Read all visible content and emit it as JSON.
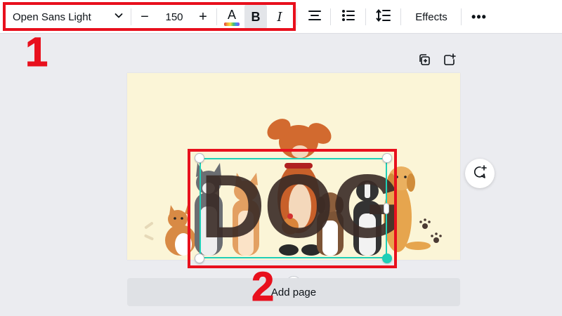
{
  "toolbar": {
    "font_family": "Open Sans Light",
    "font_size": "150",
    "minus_label": "−",
    "plus_label": "+",
    "text_color_label": "A",
    "bold_label": "B",
    "italic_label": "I",
    "effects_label": "Effects",
    "more_label": "•••"
  },
  "annotations": {
    "marker_1": "1",
    "marker_2": "2",
    "color": "#e8101d"
  },
  "canvas": {
    "text": "DOG",
    "text_color": "#3a2b26",
    "background_color": "#fbf5d7",
    "selection_color": "#1fcfb7"
  },
  "add_page_label": "Add page",
  "icons": {
    "font_dropdown": "chevron-down-icon",
    "align": "align-center-icon",
    "list": "bulleted-list-icon",
    "spacing": "line-spacing-icon",
    "duplicate_page": "duplicate-page-icon",
    "add_page_top": "add-page-icon",
    "comment": "add-comment-icon",
    "rotate": "rotate-icon"
  }
}
